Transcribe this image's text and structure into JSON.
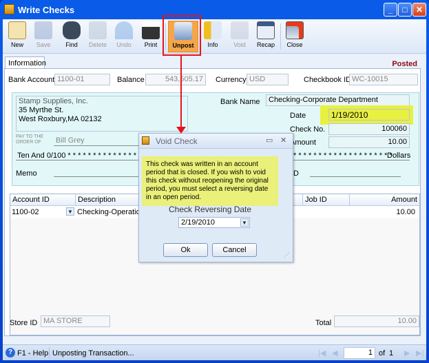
{
  "window": {
    "title": "Write Checks"
  },
  "toolbar": {
    "items": [
      {
        "label": "New",
        "icon": "new-icon",
        "enabled": true
      },
      {
        "label": "Save",
        "icon": "save-icon",
        "enabled": false
      },
      {
        "label": "Find",
        "icon": "binoculars-icon",
        "enabled": true
      },
      {
        "label": "Delete",
        "icon": "recycle-icon",
        "enabled": false
      },
      {
        "label": "Undo",
        "icon": "undo-icon",
        "enabled": false
      },
      {
        "label": "Print",
        "icon": "printer-icon",
        "enabled": true
      },
      {
        "label": "Unpost",
        "icon": "unpost-icon",
        "enabled": true,
        "active": true
      },
      {
        "label": "Info",
        "icon": "info-icon",
        "enabled": true
      },
      {
        "label": "Void",
        "icon": "void-icon",
        "enabled": false
      },
      {
        "label": "Recap",
        "icon": "recap-icon",
        "enabled": true
      },
      {
        "label": "Close",
        "icon": "close-form-icon",
        "enabled": true
      }
    ]
  },
  "tabs": [
    {
      "label": "Information",
      "active": true
    }
  ],
  "status_badge": "Posted",
  "header": {
    "bank_account_label": "Bank Account",
    "bank_account": "1100-01",
    "balance_label": "Balance",
    "balance": "543,505.17",
    "currency_label": "Currency",
    "currency": "USD",
    "checkbook_label": "Checkbook ID",
    "checkbook": "WC-10015"
  },
  "check": {
    "address": [
      "Stamp Supplies, Inc.",
      "35 Myrthe St.",
      "West Roxbury,MA 02132"
    ],
    "bank_name_label": "Bank Name",
    "bank_name": "Checking-Corporate Department",
    "date_label": "Date",
    "date": "1/19/2010",
    "check_no_label": "Check No.",
    "check_no": "100060",
    "amount_label": "Amount",
    "amount": "10.00",
    "pay_to_label1": "PAY TO THE",
    "pay_to_label2": "ORDER OF",
    "payee": "Bill Grey",
    "amount_words": "Ten And 0/100 * * * * * * * * * * * * * * * * * * * * *",
    "amount_words_tail": "* * * * * * * * * * * * * * * * * * * *",
    "dollars_label": "Dollars",
    "memo_label": "Memo",
    "partial_label": "D"
  },
  "grid": {
    "columns": [
      "Account ID",
      "Description",
      "Job ID",
      "Amount"
    ],
    "rows": [
      {
        "account_id": "1100-02",
        "description": "Checking-Operations",
        "job_id": "",
        "amount": "10.00"
      }
    ]
  },
  "footer": {
    "store_label": "Store ID",
    "store": "MA STORE",
    "total_label": "Total",
    "total": "10.00"
  },
  "statusbar": {
    "help": "F1 - Help",
    "message": "Unposting Transaction...",
    "page": "1",
    "of_label": "of",
    "total_pages": "1"
  },
  "dialog": {
    "title": "Void Check",
    "message": "This check was written in an account period that is closed. If you wish to void this check without reopening the original period, you must select a reversing date in an open period.",
    "reversing_label": "Check Reversing Date",
    "reversing_date": "2/19/2010",
    "ok": "Ok",
    "cancel": "Cancel"
  },
  "colors": {
    "highlight": "#e8f040",
    "annotation": "#e8121b",
    "posted": "#8b0a14"
  }
}
